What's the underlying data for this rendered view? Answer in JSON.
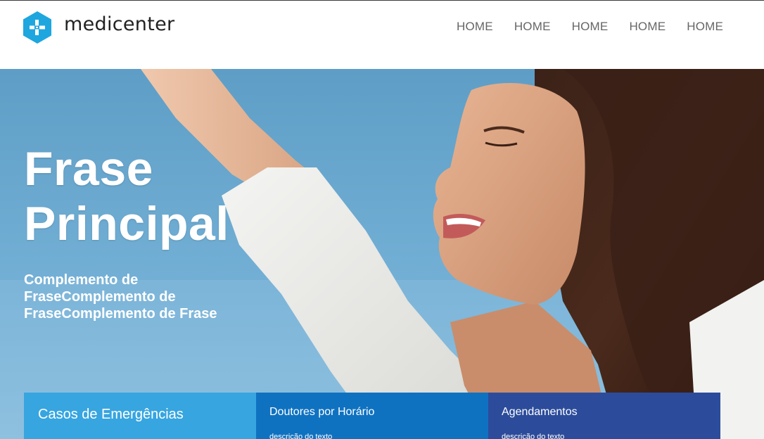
{
  "brand": {
    "name": "medicenter",
    "icon": "plus-hexagon-icon",
    "color": "#1ea6df"
  },
  "nav": {
    "items": [
      "HOME",
      "HOME",
      "HOME",
      "HOME",
      "HOME"
    ]
  },
  "hero": {
    "title_line1": "Frase",
    "title_line2": "Principal",
    "subtitle": "Complemento de FraseComplemento de FraseComplemento de Frase"
  },
  "cards": [
    {
      "title": "Casos de Emergências",
      "description": "",
      "color": "#37a5e0"
    },
    {
      "title": "Doutores por Horário",
      "description": "descrição do texto",
      "color": "#0f72c1"
    },
    {
      "title": "Agendamentos",
      "description": "descrição do texto",
      "color": "#2c4c9b"
    }
  ]
}
